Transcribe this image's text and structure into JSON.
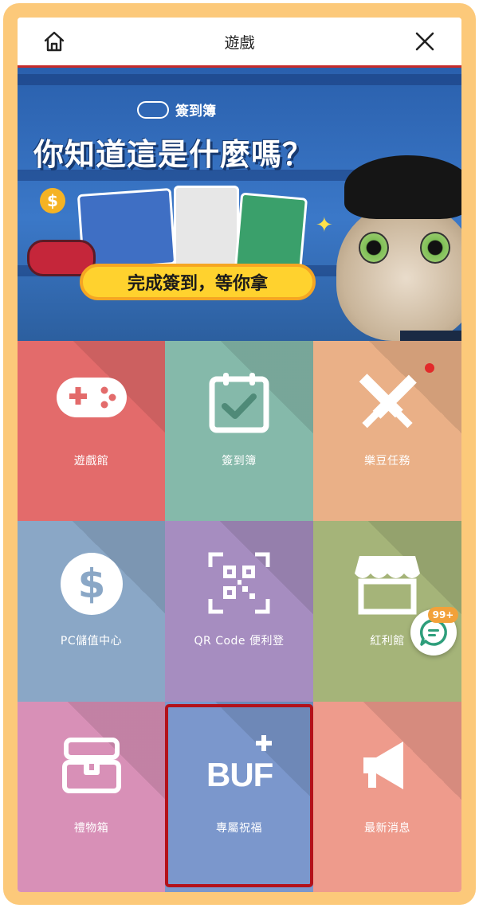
{
  "header": {
    "title": "遊戲",
    "home_icon": "home-icon",
    "close_icon": "close-icon"
  },
  "banner": {
    "brand_text": "簽到簿",
    "headline": "你知道這是什麼嗎？",
    "cta": "完成簽到，等你拿",
    "coin_symbol": "$"
  },
  "tiles": [
    {
      "label": "遊戲館",
      "icon": "gamepad-icon",
      "color": "#e36b6b"
    },
    {
      "label": "簽到簿",
      "icon": "calendar-check-icon",
      "color": "#85b9aa"
    },
    {
      "label": "樂豆任務",
      "icon": "crossed-swords-icon",
      "color": "#eab087",
      "notification_dot": true
    },
    {
      "label": "PC儲值中心",
      "icon": "dollar-coin-icon",
      "color": "#8aa7c6"
    },
    {
      "label": "QR Code 便利登",
      "icon": "qr-code-icon",
      "color": "#a68dc0"
    },
    {
      "label": "紅利館",
      "icon": "shop-icon",
      "color": "#a5b479"
    },
    {
      "label": "禮物箱",
      "icon": "gift-chest-icon",
      "color": "#d890b7"
    },
    {
      "label": "專屬祝福",
      "icon": "buff-icon",
      "color": "#7b97cc",
      "selected": true
    },
    {
      "label": "最新消息",
      "icon": "megaphone-icon",
      "color": "#ee9b8c"
    }
  ],
  "chat": {
    "badge": "99+",
    "icon": "chat-icon"
  }
}
